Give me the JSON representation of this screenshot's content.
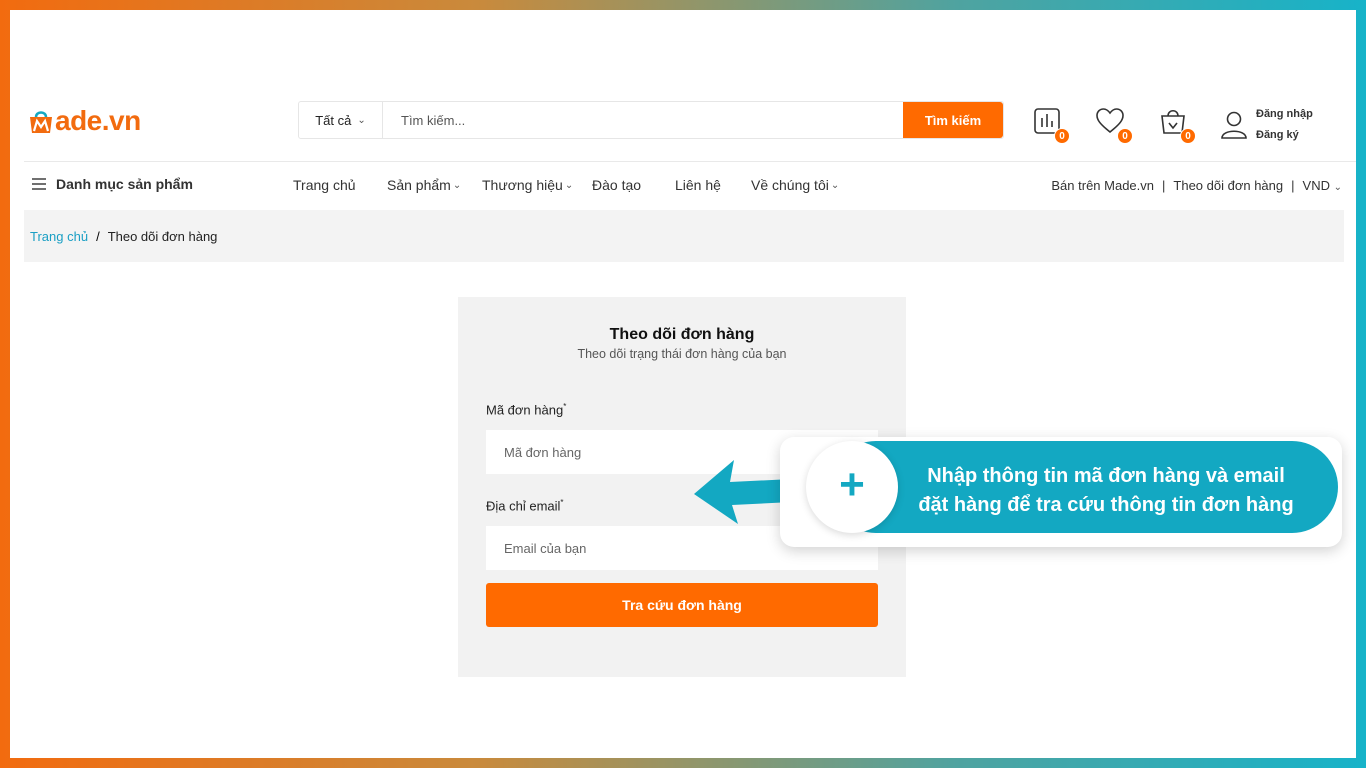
{
  "brand": {
    "logo_prefix": "M",
    "logo_rest": "ade",
    "logo_domain": ".vn",
    "accent": "#ff6a00",
    "link": "#1a9fc4",
    "callout": "#13a8c2"
  },
  "search": {
    "category": "Tất cả",
    "placeholder": "Tìm kiếm...",
    "button": "Tìm kiếm"
  },
  "header_icons": [
    {
      "name": "compare-icon",
      "count": "0"
    },
    {
      "name": "heart-icon",
      "count": "0"
    },
    {
      "name": "cart-icon",
      "count": "0"
    }
  ],
  "account": {
    "login": "Đăng nhập",
    "register": "Đăng ký"
  },
  "nav": {
    "categories": "Danh mục sản phẩm",
    "items": [
      "Trang chủ",
      "Sản phẩm",
      "Thương hiệu",
      "Đào tạo",
      "Liên hệ",
      "Về chúng tôi"
    ],
    "right": {
      "sell": "Bán trên Made.vn",
      "track": "Theo dõi đơn hàng",
      "currency": "VND"
    }
  },
  "breadcrumb": {
    "home": "Trang chủ",
    "sep": "/",
    "current": "Theo dõi đơn hàng"
  },
  "form": {
    "title": "Theo dõi đơn hàng",
    "subtitle": "Theo dõi trạng thái đơn hàng của bạn",
    "order_label": "Mã đơn hàng",
    "order_placeholder": "Mã đơn hàng",
    "email_label": "Địa chỉ email",
    "email_placeholder": "Email của bạn",
    "required_mark": "*",
    "submit": "Tra cứu đơn hàng"
  },
  "callout": {
    "line1": "Nhập thông tin mã đơn hàng và email",
    "line2": "đặt hàng để tra cứu thông tin đơn hàng",
    "plus": "+"
  }
}
